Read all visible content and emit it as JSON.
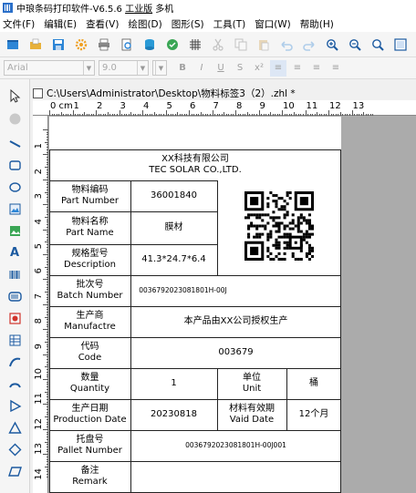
{
  "app": {
    "title": "中琅条码打印软件-V6.5.6",
    "edition": "工业版",
    "mode": "多机"
  },
  "menu": [
    {
      "label": "文件(F)"
    },
    {
      "label": "编辑(E)"
    },
    {
      "label": "查看(V)"
    },
    {
      "label": "绘图(D)"
    },
    {
      "label": "图形(S)"
    },
    {
      "label": "工具(T)"
    },
    {
      "label": "窗口(W)"
    },
    {
      "label": "帮助(H)"
    }
  ],
  "format": {
    "font": "Arial",
    "size": "9.0"
  },
  "document": {
    "path": "C:\\Users\\Administrator\\Desktop\\物料标签3（2）.zhl *"
  },
  "ruler": {
    "unit": "cm",
    "top_ticks": [
      "0",
      "1",
      "2",
      "3",
      "4",
      "5",
      "6",
      "7",
      "8",
      "9",
      "10",
      "11",
      "12",
      "13"
    ],
    "left_ticks": [
      "1",
      "2",
      "3",
      "4",
      "5",
      "6",
      "7",
      "8",
      "9",
      "10",
      "11",
      "12",
      "13",
      "14"
    ]
  },
  "label": {
    "company_cn": "XX科技有限公司",
    "company_en": "TEC SOLAR CO.,LTD.",
    "part_number_cn": "物料编码",
    "part_number_en": "Part Number",
    "part_number": "36001840",
    "part_name_cn": "物料名称",
    "part_name_en": "Part Name",
    "part_name": "膜材",
    "desc_cn": "规格型号",
    "desc_en": "Description",
    "description": "41.3*24.7*6.4",
    "batch_cn": "批次号",
    "batch_en": "Batch Number",
    "batch": "0036792023081801H-00J",
    "mfr_cn": "生产商",
    "mfr_en": "Manufactre",
    "manufacturer": "本产品由XX公司授权生产",
    "code_cn": "代码",
    "code_en": "Code",
    "code": "003679",
    "qty_cn": "数量",
    "qty_en": "Quantity",
    "quantity": "1",
    "unit_cn": "单位",
    "unit_en": "Unit",
    "unit": "桶",
    "prod_cn": "生产日期",
    "prod_en": "Production Date",
    "production_date": "20230818",
    "valid_cn": "材料有效期",
    "valid_en": "Vaid Date",
    "valid_date": "12个月",
    "pallet_cn": "托盘号",
    "pallet_en": "Pallet Number",
    "pallet": "0036792023081801H-00J001",
    "remark_cn": "备注",
    "remark_en": "Remark"
  },
  "toolbar_icons": [
    "new-file-icon",
    "open-folder-icon",
    "save-icon",
    "settings-gear-icon",
    "print-icon",
    "print-preview-icon",
    "database-icon",
    "batch-icon",
    "grid-icon",
    "cut-icon",
    "copy-icon",
    "paste-icon",
    "undo-icon",
    "redo-icon",
    "zoom-in-icon",
    "zoom-out-icon",
    "zoom-fit-icon",
    "zoom-page-icon"
  ],
  "left_tools": [
    "select-arrow-icon",
    "pan-icon",
    "line-icon",
    "rectangle-icon",
    "ellipse-icon",
    "image-icon",
    "picture-icon",
    "text-icon",
    "barcode-icon",
    "dynamic-code-icon",
    "shape-icon",
    "table-icon",
    "curve-icon",
    "arc-icon",
    "polygon-icon",
    "triangle-icon",
    "diamond-icon",
    "parallelogram-icon"
  ]
}
